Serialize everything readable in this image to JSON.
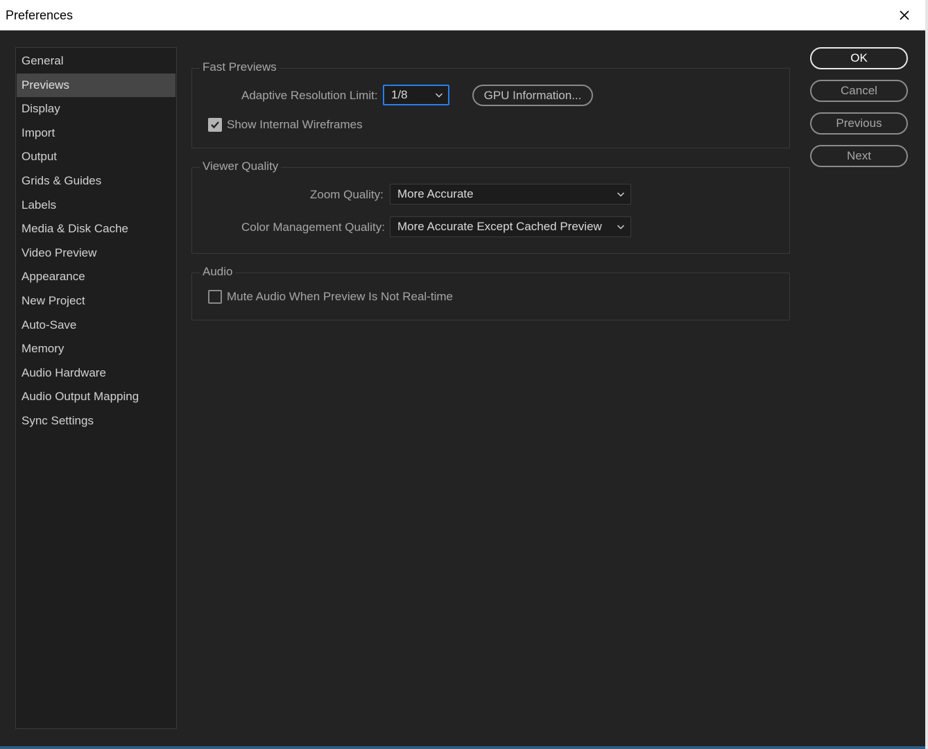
{
  "window": {
    "title": "Preferences"
  },
  "sidebar": {
    "items": [
      {
        "label": "General",
        "active": false
      },
      {
        "label": "Previews",
        "active": true
      },
      {
        "label": "Display",
        "active": false
      },
      {
        "label": "Import",
        "active": false
      },
      {
        "label": "Output",
        "active": false
      },
      {
        "label": "Grids & Guides",
        "active": false
      },
      {
        "label": "Labels",
        "active": false
      },
      {
        "label": "Media & Disk Cache",
        "active": false
      },
      {
        "label": "Video Preview",
        "active": false
      },
      {
        "label": "Appearance",
        "active": false
      },
      {
        "label": "New Project",
        "active": false
      },
      {
        "label": "Auto-Save",
        "active": false
      },
      {
        "label": "Memory",
        "active": false
      },
      {
        "label": "Audio Hardware",
        "active": false
      },
      {
        "label": "Audio Output Mapping",
        "active": false
      },
      {
        "label": "Sync Settings",
        "active": false
      }
    ]
  },
  "fast_previews": {
    "title": "Fast Previews",
    "adaptive_label": "Adaptive Resolution Limit:",
    "adaptive_value": "1/8",
    "gpu_button": "GPU Information...",
    "wireframes_label": "Show Internal Wireframes",
    "wireframes_checked": true
  },
  "viewer_quality": {
    "title": "Viewer Quality",
    "zoom_label": "Zoom Quality:",
    "zoom_value": "More Accurate",
    "color_label": "Color Management Quality:",
    "color_value": "More Accurate Except Cached Preview"
  },
  "audio": {
    "title": "Audio",
    "mute_label": "Mute Audio When Preview Is Not Real-time",
    "mute_checked": false
  },
  "actions": {
    "ok": "OK",
    "cancel": "Cancel",
    "previous": "Previous",
    "next": "Next"
  },
  "colors": {
    "background": "#232323",
    "sidebar_active": "#464646",
    "focus_accent": "#2680eb"
  }
}
